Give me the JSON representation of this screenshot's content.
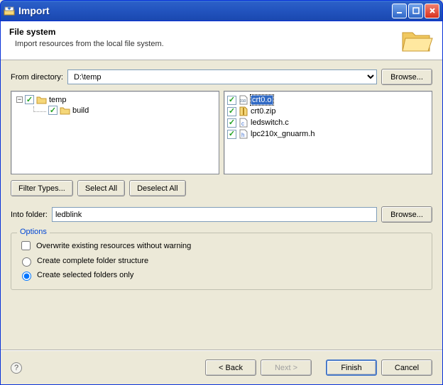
{
  "window": {
    "title": "Import"
  },
  "header": {
    "title": "File system",
    "description": "Import resources from the local file system."
  },
  "from_directory": {
    "label": "From directory:",
    "value": "D:\\temp",
    "browse": "Browse..."
  },
  "tree_left": [
    {
      "indent": 0,
      "expander": "-",
      "checked": true,
      "icon": "folder",
      "label": "temp"
    },
    {
      "indent": 1,
      "expander": "",
      "checked": true,
      "icon": "folder",
      "label": "build"
    }
  ],
  "tree_right": [
    {
      "checked": true,
      "icon": "binfile",
      "label": "crt0.o",
      "selected": true
    },
    {
      "checked": true,
      "icon": "zipfile",
      "label": "crt0.zip"
    },
    {
      "checked": true,
      "icon": "cfile",
      "label": "ledswitch.c"
    },
    {
      "checked": true,
      "icon": "hfile",
      "label": "lpc210x_gnuarm.h"
    }
  ],
  "buttons": {
    "filter_types": "Filter Types...",
    "select_all": "Select All",
    "deselect_all": "Deselect All"
  },
  "into_folder": {
    "label": "Into folder:",
    "value": "ledblink",
    "browse": "Browse..."
  },
  "options": {
    "legend": "Options",
    "overwrite": {
      "label": "Overwrite existing resources without warning",
      "checked": false
    },
    "complete_structure": {
      "label": "Create complete folder structure",
      "selected": false
    },
    "selected_only": {
      "label": "Create selected folders only",
      "selected": true
    }
  },
  "footer": {
    "back": "< Back",
    "next": "Next >",
    "finish": "Finish",
    "cancel": "Cancel"
  }
}
